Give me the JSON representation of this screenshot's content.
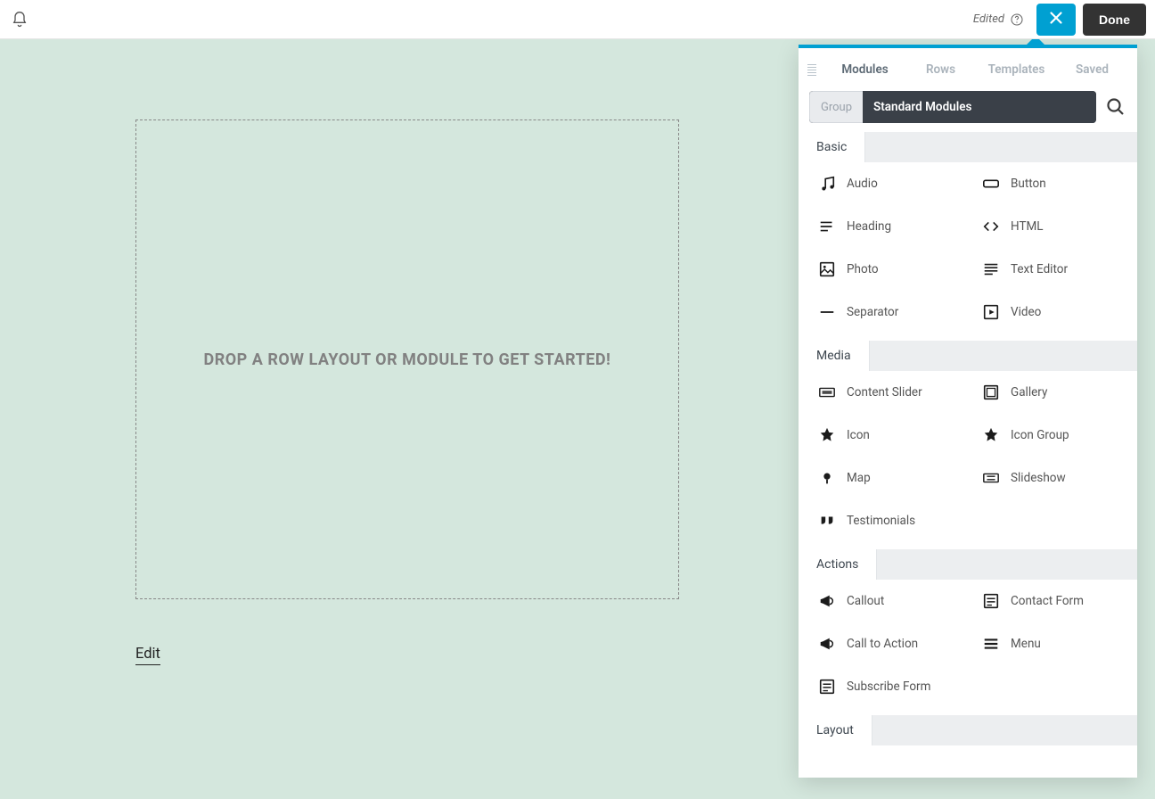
{
  "topbar": {
    "edited_label": "Edited",
    "done_label": "Done"
  },
  "canvas": {
    "dropzone_text": "DROP A ROW LAYOUT OR MODULE TO GET STARTED!",
    "edit_label": "Edit"
  },
  "panel": {
    "tabs": [
      "Modules",
      "Rows",
      "Templates",
      "Saved"
    ],
    "active_tab_index": 0,
    "group_label": "Group",
    "group_value": "Standard Modules",
    "sections": [
      {
        "title": "Basic",
        "items": [
          {
            "label": "Audio",
            "icon": "music"
          },
          {
            "label": "Button",
            "icon": "button"
          },
          {
            "label": "Heading",
            "icon": "heading"
          },
          {
            "label": "HTML",
            "icon": "code"
          },
          {
            "label": "Photo",
            "icon": "photo"
          },
          {
            "label": "Text Editor",
            "icon": "text"
          },
          {
            "label": "Separator",
            "icon": "separator"
          },
          {
            "label": "Video",
            "icon": "video"
          }
        ]
      },
      {
        "title": "Media",
        "items": [
          {
            "label": "Content Slider",
            "icon": "slider"
          },
          {
            "label": "Gallery",
            "icon": "gallery"
          },
          {
            "label": "Icon",
            "icon": "star"
          },
          {
            "label": "Icon Group",
            "icon": "star"
          },
          {
            "label": "Map",
            "icon": "map"
          },
          {
            "label": "Slideshow",
            "icon": "slideshow"
          },
          {
            "label": "Testimonials",
            "icon": "quote"
          }
        ]
      },
      {
        "title": "Actions",
        "items": [
          {
            "label": "Callout",
            "icon": "megaphone"
          },
          {
            "label": "Contact Form",
            "icon": "form"
          },
          {
            "label": "Call to Action",
            "icon": "megaphone"
          },
          {
            "label": "Menu",
            "icon": "menu"
          },
          {
            "label": "Subscribe Form",
            "icon": "form"
          }
        ]
      },
      {
        "title": "Layout",
        "items": []
      }
    ]
  }
}
